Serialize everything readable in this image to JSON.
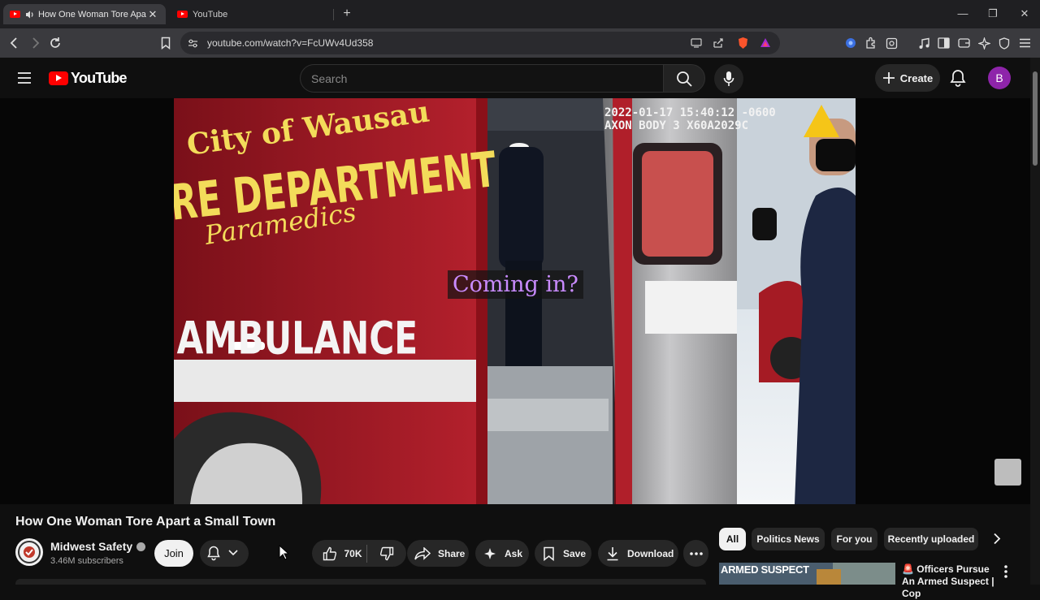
{
  "browser": {
    "tabs": [
      {
        "title": "How One Woman Tore Apart a Small Town",
        "active": true
      },
      {
        "title": "YouTube",
        "active": false
      }
    ],
    "url": "youtube.com/watch?v=FcUWv4Ud358"
  },
  "header": {
    "logo_text": "YouTube",
    "search_placeholder": "Search",
    "create_label": "Create",
    "avatar_letter": "B"
  },
  "video": {
    "overlay_timestamp": "2022-01-17 15:40:12 -0600",
    "overlay_device": "AXON BODY 3 X60A2029C",
    "caption": "Coming in?",
    "ambulance_text": {
      "line1": "City of Wausau",
      "line2": "RE DEPARTMENT",
      "line3": "Paramedics",
      "line4": "AMBULANCE"
    }
  },
  "details": {
    "title": "How One Woman Tore Apart a Small Town",
    "channel_name": "Midwest Safety",
    "subscribers": "3.46M subscribers",
    "join_label": "Join",
    "like_count": "70K",
    "share_label": "Share",
    "ask_label": "Ask",
    "save_label": "Save",
    "download_label": "Download"
  },
  "sidebar": {
    "chips": [
      "All",
      "Politics News",
      "For you",
      "Recently uploaded"
    ],
    "recommendation": {
      "thumb_text": "ARMED SUSPECT",
      "title": "Officers Pursue An Armed Suspect | Cop"
    }
  },
  "colors": {
    "background": "#0f0f0f",
    "brand_red": "#ff0000",
    "avatar_purple": "#8e24aa",
    "caption_purple": "#c98bff"
  }
}
